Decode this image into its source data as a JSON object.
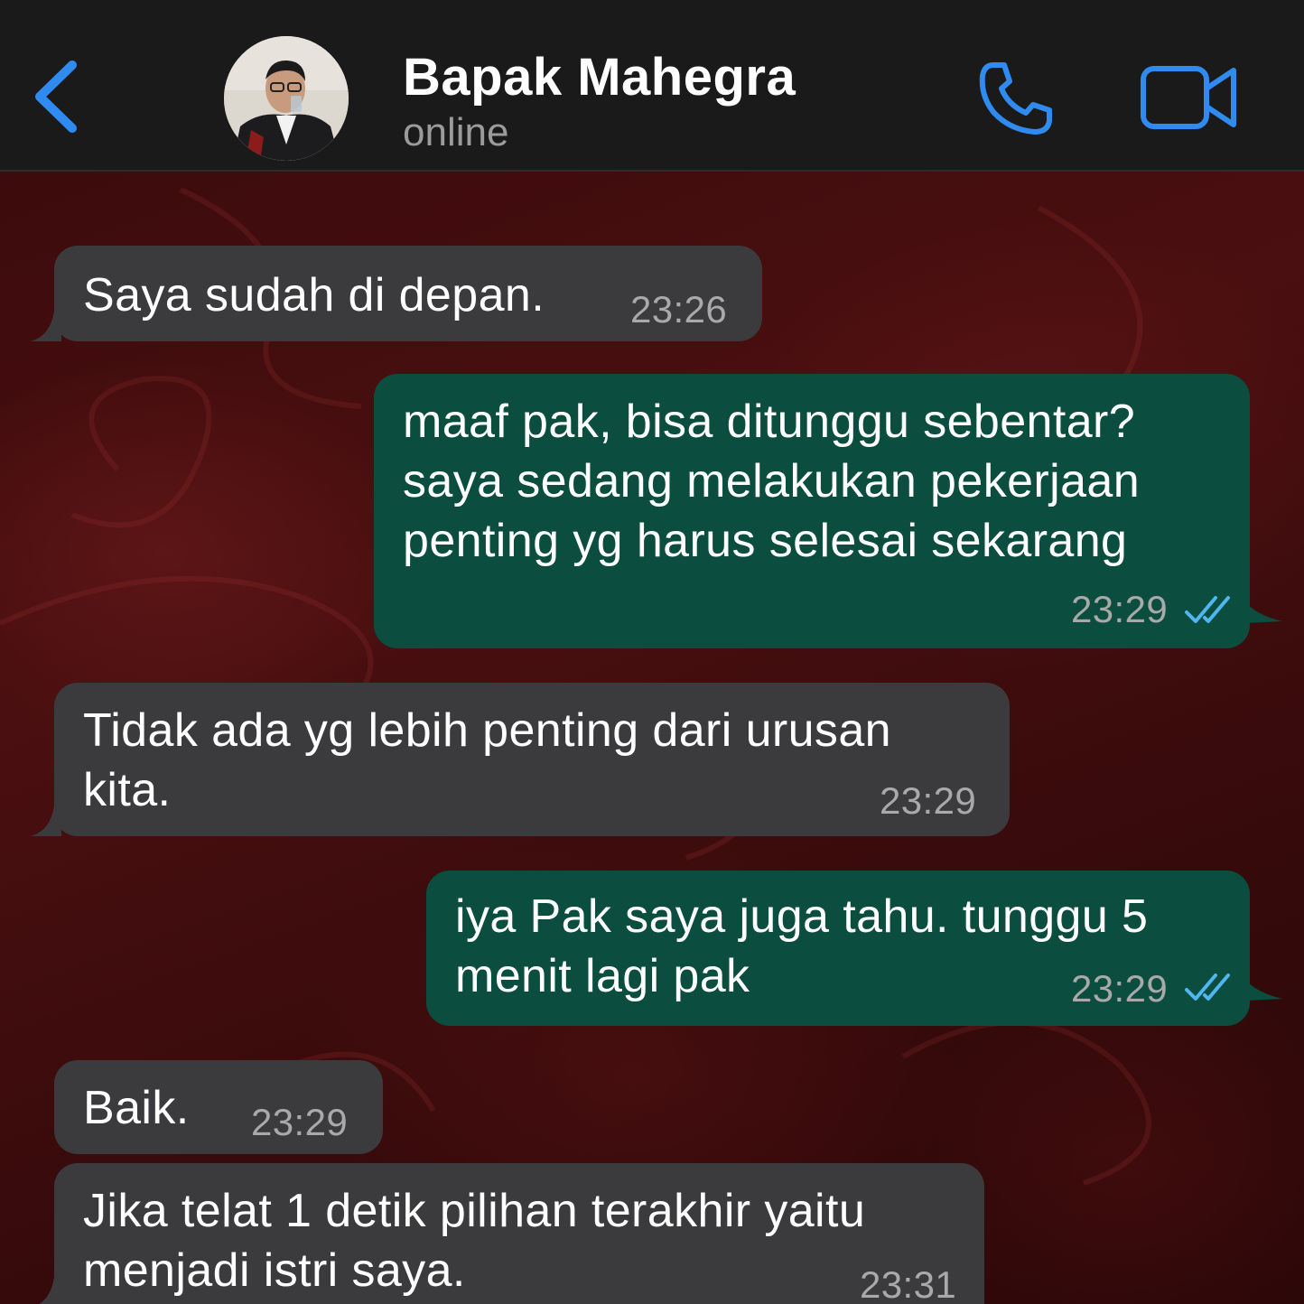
{
  "header": {
    "contact_name": "Bapak Mahegra",
    "status": "online",
    "icons": {
      "back": "chevron-left-icon",
      "call": "phone-icon",
      "video": "video-camera-icon"
    },
    "accent_color": "#2f8bf0"
  },
  "messages": [
    {
      "direction": "incoming",
      "text": "Saya sudah di depan.",
      "time": "23:26"
    },
    {
      "direction": "outgoing",
      "text": "maaf pak, bisa ditunggu sebentar?\nsaya sedang melakukan pekerjaan\npenting yg harus selesai sekarang",
      "time": "23:29",
      "status": "read"
    },
    {
      "direction": "incoming",
      "text": "Tidak ada yg lebih penting dari urusan\nkita.",
      "time": "23:29"
    },
    {
      "direction": "outgoing",
      "text": "iya Pak saya juga tahu. tunggu 5\nmenit lagi pak",
      "time": "23:29",
      "status": "read"
    },
    {
      "direction": "incoming",
      "text": "Baik.",
      "time": "23:29"
    },
    {
      "direction": "incoming",
      "text": "Jika telat 1 detik pilihan terakhir yaitu\nmenjadi istri saya.",
      "time": "23:31"
    }
  ],
  "colors": {
    "incoming_bubble": "#3b3b3d",
    "outgoing_bubble": "#0b4d3f",
    "read_ticks": "#4fb6f0",
    "chat_background": "#3d0b0d"
  }
}
